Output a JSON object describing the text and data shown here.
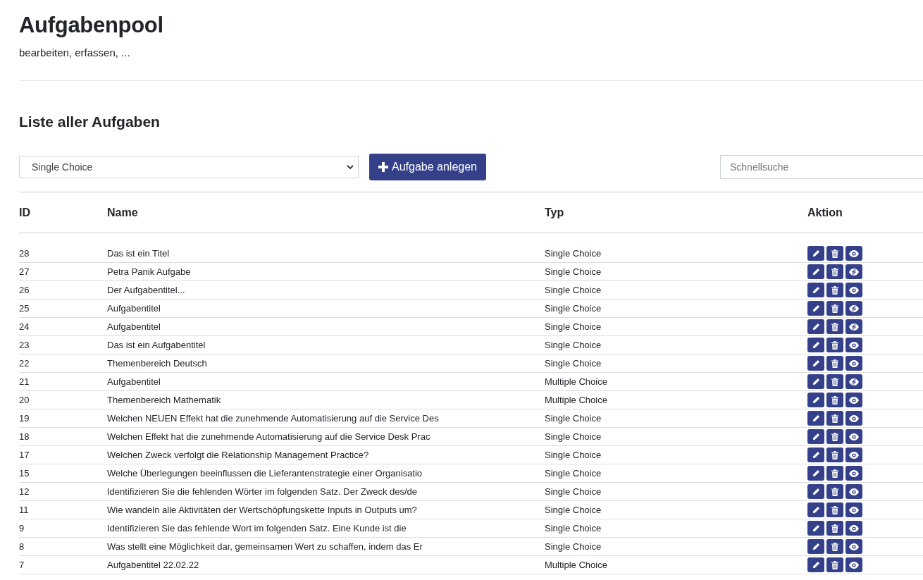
{
  "page": {
    "title": "Aufgabenpool",
    "subtitle": "bearbeiten, erfassen, ..."
  },
  "section_title": "Liste aller Aufgaben",
  "toolbar": {
    "type_select": "Single Choice",
    "add_button": "Aufgabe anlegen",
    "search": {
      "placeholder": "Schnellsuche"
    }
  },
  "table": {
    "columns": [
      "ID",
      "Name",
      "Typ",
      "Aktion"
    ],
    "rows": [
      {
        "id": "28",
        "name": "Das ist ein Titel",
        "type": "Single Choice",
        "visible": true
      },
      {
        "id": "27",
        "name": "Petra Panik Aufgabe",
        "type": "Single Choice",
        "visible": false
      },
      {
        "id": "26",
        "name": "Der Aufgabentitel...",
        "type": "Single Choice",
        "visible": true
      },
      {
        "id": "25",
        "name": "Aufgabentitel",
        "type": "Single Choice",
        "visible": false
      },
      {
        "id": "24",
        "name": "Aufgabentitel",
        "type": "Single Choice",
        "visible": false
      },
      {
        "id": "23",
        "name": "Das ist ein Aufgabentitel",
        "type": "Single Choice",
        "visible": true
      },
      {
        "id": "22",
        "name": "Themenbereich Deutsch",
        "type": "Single Choice",
        "visible": true
      },
      {
        "id": "21",
        "name": "Aufgabentitel",
        "type": "Multiple Choice",
        "visible": false
      },
      {
        "id": "20",
        "name": "Themenbereich Mathematik",
        "type": "Multiple Choice",
        "visible": true
      },
      {
        "id": "19",
        "name": "Welchen NEUEN Effekt hat die zunehmende Automatisierung auf die Service Des",
        "type": "Single Choice",
        "visible": true
      },
      {
        "id": "18",
        "name": "Welchen Effekt hat die zunehmende Automatisierung auf die Service Desk Prac",
        "type": "Single Choice",
        "visible": true
      },
      {
        "id": "17",
        "name": "Welchen Zweck verfolgt die Relationship Management Practice?",
        "type": "Single Choice",
        "visible": true
      },
      {
        "id": "15",
        "name": "Welche Überlegungen beeinflussen die Lieferantenstrategie einer Organisatio",
        "type": "Single Choice",
        "visible": true
      },
      {
        "id": "12",
        "name": "Identifizieren Sie die fehlenden Wörter im folgenden Satz. Der Zweck des/de",
        "type": "Single Choice",
        "visible": true
      },
      {
        "id": "11",
        "name": "Wie wandeln alle Aktivitäten der Wertschöpfungskette Inputs in Outputs um?",
        "type": "Single Choice",
        "visible": true
      },
      {
        "id": "9",
        "name": "Identifizieren Sie das fehlende Wort im folgenden Satz. Eine Kunde ist die",
        "type": "Single Choice",
        "visible": true
      },
      {
        "id": "8",
        "name": "Was stellt eine Möglichkeit dar, gemeinsamen Wert zu schaffen, indem das Er",
        "type": "Single Choice",
        "visible": true
      },
      {
        "id": "7",
        "name": "Aufgabentitel 22.02.22",
        "type": "Multiple Choice",
        "visible": true
      }
    ]
  }
}
